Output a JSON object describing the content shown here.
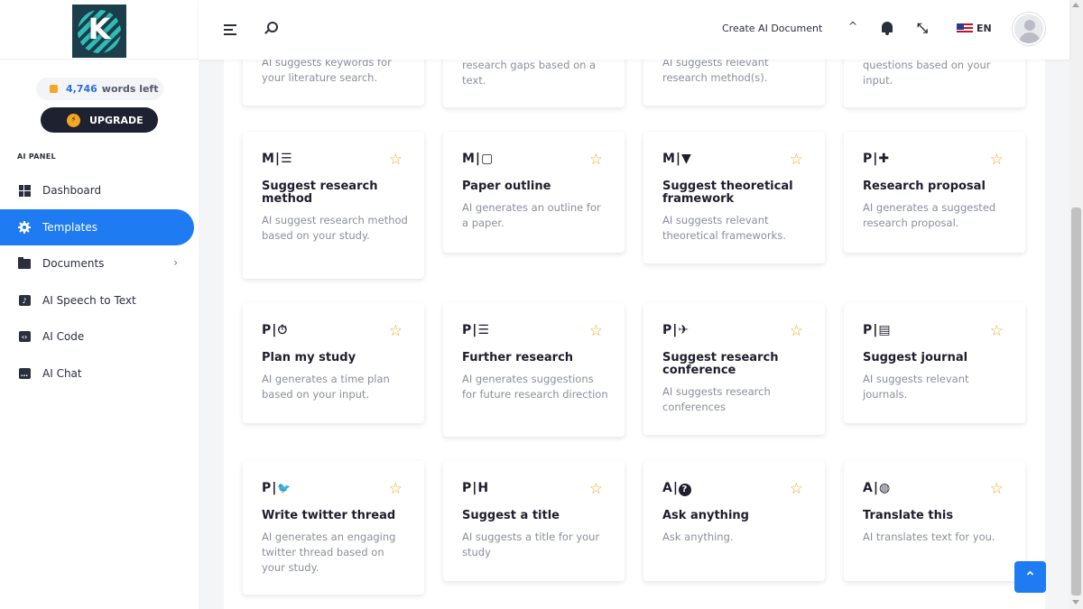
{
  "sidebar": {
    "logo_letter": "K",
    "words_count": "4,746",
    "words_label": "words left",
    "upgrade_label": "UPGRADE",
    "panel_title": "AI PANEL",
    "items": [
      {
        "label": "Dashboard",
        "icon": "dashboard-icon"
      },
      {
        "label": "Templates",
        "icon": "templates-icon",
        "active": true
      },
      {
        "label": "Documents",
        "icon": "folder-icon",
        "has_submenu": true
      },
      {
        "label": "AI Speech to Text",
        "icon": "speech-icon"
      },
      {
        "label": "AI Code",
        "icon": "code-icon"
      },
      {
        "label": "AI Chat",
        "icon": "chat-icon"
      }
    ]
  },
  "header": {
    "create_label": "Create AI Document",
    "caret": "^",
    "language": "EN"
  },
  "cards_partial": [
    {
      "desc": "AI suggests keywords for your literature search."
    },
    {
      "desc": "research gaps based on a text."
    },
    {
      "desc": "AI suggests relevant research method(s)."
    },
    {
      "desc": "questions based on your input."
    }
  ],
  "cards": [
    {
      "prefix": "M|",
      "glyph": "☰",
      "icon": "signpost-icon",
      "title": "Suggest research method",
      "desc": "AI suggest research method based on your study."
    },
    {
      "prefix": "M|",
      "glyph": "▢",
      "icon": "outline-icon",
      "title": "Paper outline",
      "desc": "AI generates an outline for a paper."
    },
    {
      "prefix": "M|",
      "glyph": "▼",
      "icon": "filter-icon",
      "title": "Suggest theoretical framework",
      "desc": "AI suggests relevant theoretical frameworks."
    },
    {
      "prefix": "P|",
      "glyph": "✚",
      "icon": "puzzle-icon",
      "title": "Research proposal",
      "desc": "AI generates a suggested research proposal."
    },
    {
      "prefix": "P|",
      "glyph": "⏱",
      "icon": "stopwatch-icon",
      "title": "Plan my study",
      "desc": "AI generates a time plan based on your input."
    },
    {
      "prefix": "P|",
      "glyph": "☰",
      "icon": "signpost-icon",
      "title": "Further research",
      "desc": "AI generates suggestions for future research direction"
    },
    {
      "prefix": "P|",
      "glyph": "✈",
      "icon": "plane-icon",
      "title": "Suggest research conference",
      "desc": "AI suggests research conferences"
    },
    {
      "prefix": "P|",
      "glyph": "▤",
      "icon": "newspaper-icon",
      "title": "Suggest journal",
      "desc": "AI suggests relevant journals."
    },
    {
      "prefix": "P|",
      "glyph": "🐦",
      "icon": "twitter-icon",
      "title": "Write twitter thread",
      "desc": "AI generates an engaging twitter thread based on your study."
    },
    {
      "prefix": "P|",
      "glyph": "H",
      "icon": "heading-icon",
      "title": "Suggest a title",
      "desc": "AI suggests a title for your study"
    },
    {
      "prefix": "A|",
      "glyph": "?",
      "icon": "question-icon",
      "title": "Ask anything",
      "desc": "Ask anything."
    },
    {
      "prefix": "A|",
      "glyph": "◍",
      "icon": "globe-icon",
      "title": "Translate this",
      "desc": "AI translates text for you."
    }
  ],
  "star_glyph": "☆",
  "scroll_top_glyph": "⌃"
}
